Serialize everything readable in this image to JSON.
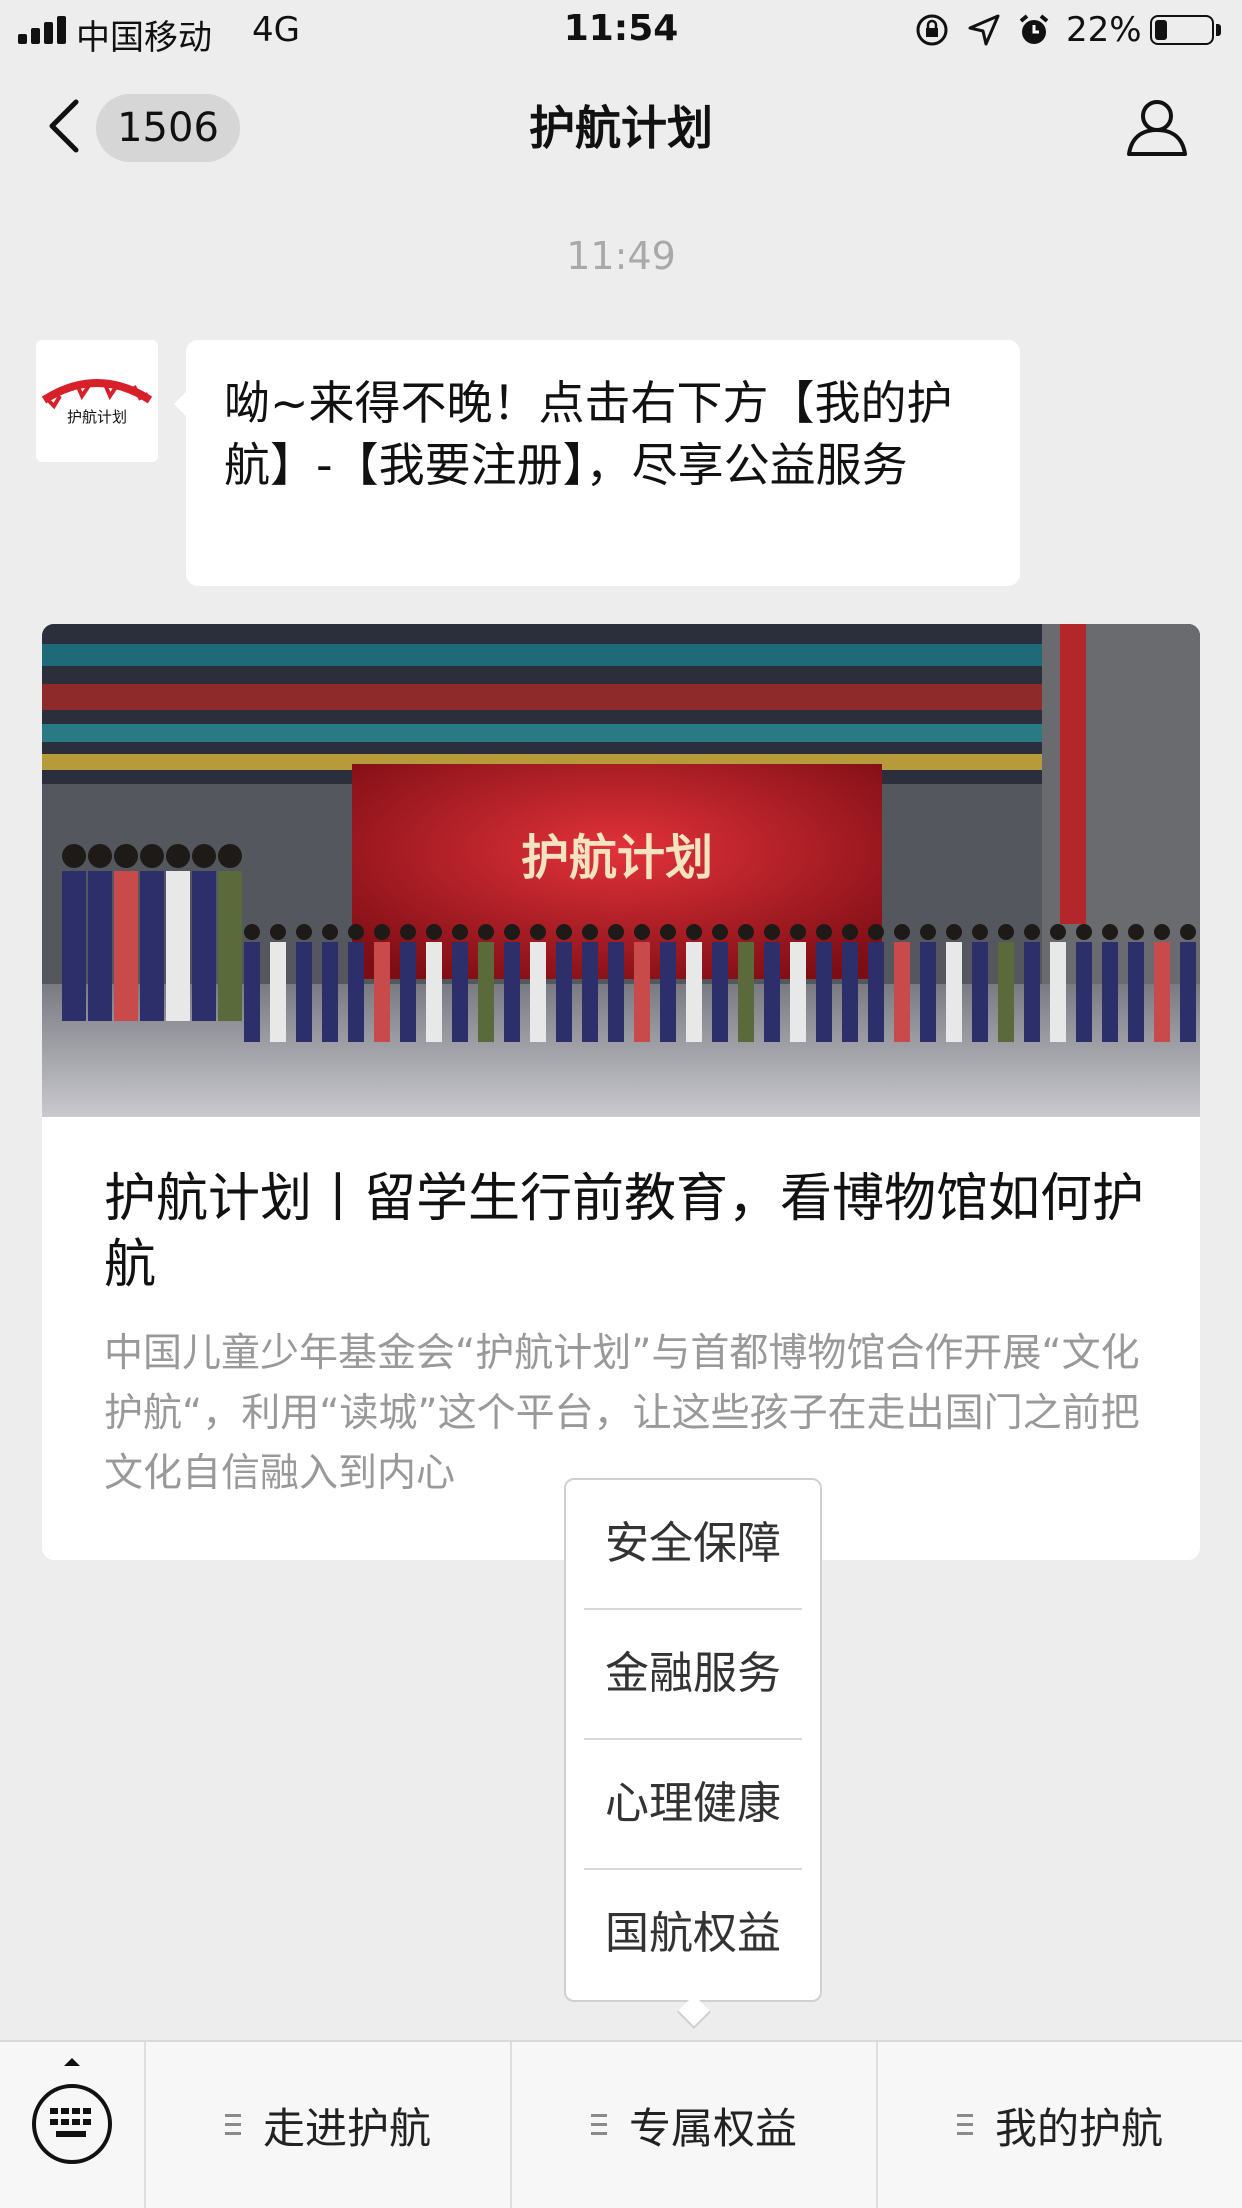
{
  "status_bar": {
    "carrier": "中国移动",
    "network": "4G",
    "time": "11:54",
    "battery_percent": "22%",
    "battery_level": 0.22
  },
  "nav": {
    "unread_count": "1506",
    "title": "护航计划"
  },
  "chat": {
    "timestamp": "11:49",
    "avatar_text": "护航计划",
    "message": "呦~来得不晚！点击右下方【我的护航】-【我要注册】，尽享公益服务"
  },
  "article": {
    "banner_text": "护航计划",
    "title": "护航计划丨留学生行前教育，看博物馆如何护航",
    "description": "中国儿童少年基金会“护航计划”与首都博物馆合作开展“文化护航“，利用“读城”这个平台，让这些孩子在走出国门之前把文化自信融入到内心"
  },
  "popup_menu": {
    "items": [
      "安全保障",
      "金融服务",
      "心理健康",
      "国航权益"
    ]
  },
  "bottom_menu": {
    "items": [
      "走进护航",
      "专属权益",
      "我的护航"
    ]
  },
  "icons": {
    "back": "chevron-left-icon",
    "profile": "person-icon",
    "keyboard": "keyboard-icon",
    "menu": "menu-lines-icon"
  },
  "colors": {
    "background": "#ededed",
    "bubble": "#ffffff",
    "logo_red": "#d8202a"
  }
}
